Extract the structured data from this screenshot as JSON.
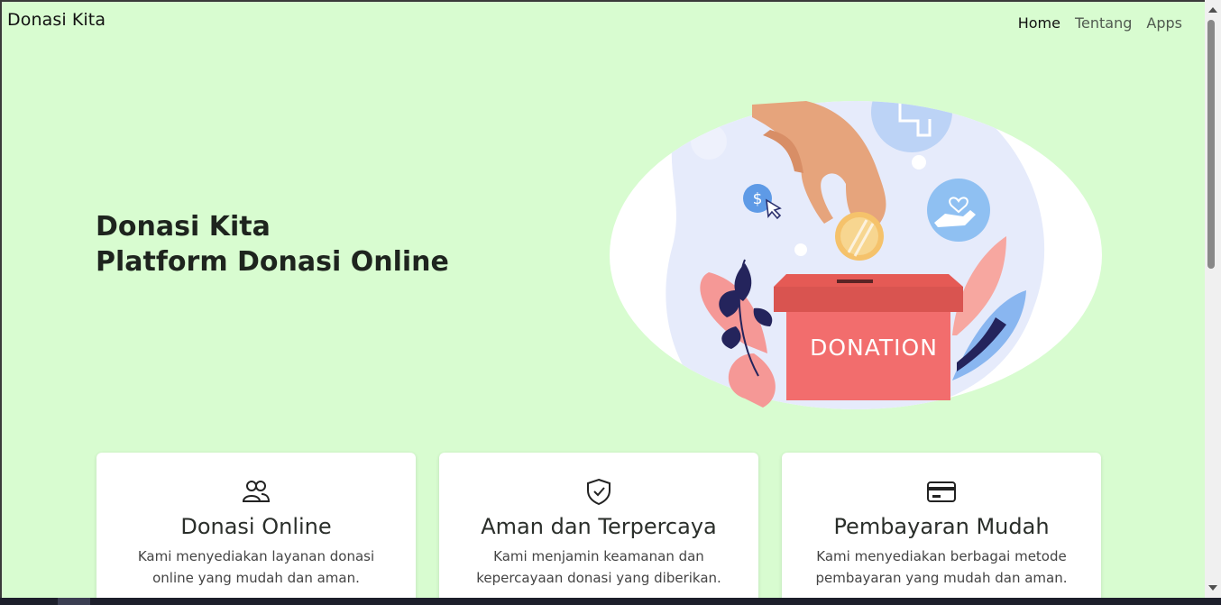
{
  "brand": "Donasi Kita",
  "nav": {
    "home": "Home",
    "about": "Tentang",
    "apps": "Apps"
  },
  "hero": {
    "title_line1": "Donasi Kita",
    "title_line2": "Platform Donasi Online",
    "illustration_label": "DONATION"
  },
  "features": [
    {
      "icon": "users-icon",
      "title": "Donasi Online",
      "desc": "Kami menyediakan layanan donasi online yang mudah dan aman."
    },
    {
      "icon": "shield-check-icon",
      "title": "Aman dan Terpercaya",
      "desc": "Kami menjamin keamanan dan kepercayaan donasi yang diberikan."
    },
    {
      "icon": "credit-card-icon",
      "title": "Pembayaran Mudah",
      "desc": "Kami menyediakan berbagai metode pembayaran yang mudah dan aman."
    }
  ],
  "colors": {
    "background": "#d8fcd0",
    "donation_box": "#f26d6d",
    "hand": "#e8a57f",
    "coin": "#f5c26b"
  }
}
